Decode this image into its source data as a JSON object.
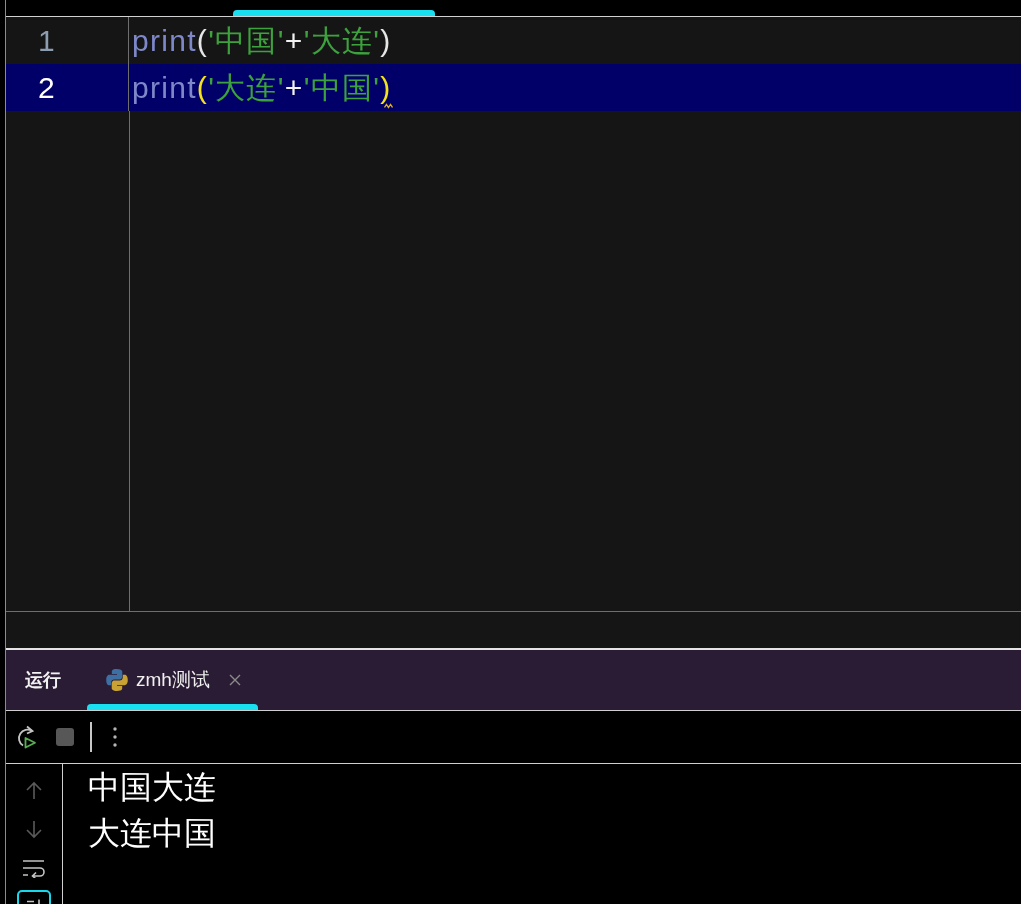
{
  "editor": {
    "lines": [
      {
        "number": "1",
        "selected": false,
        "bracket_match": false,
        "squiggle": false,
        "tokens": [
          {
            "kind": "name",
            "text": "print"
          },
          {
            "kind": "paren",
            "text": "("
          },
          {
            "kind": "string",
            "text": "'中国'"
          },
          {
            "kind": "operator",
            "text": "+"
          },
          {
            "kind": "string",
            "text": "'大连'"
          },
          {
            "kind": "paren",
            "text": ")"
          }
        ]
      },
      {
        "number": "2",
        "selected": true,
        "bracket_match": true,
        "squiggle": true,
        "tokens": [
          {
            "kind": "name",
            "text": "print"
          },
          {
            "kind": "paren",
            "text": "("
          },
          {
            "kind": "string",
            "text": "'大连'"
          },
          {
            "kind": "operator",
            "text": "+"
          },
          {
            "kind": "string",
            "text": "'中国'"
          },
          {
            "kind": "paren",
            "text": ")"
          }
        ]
      }
    ]
  },
  "run_panel": {
    "title": "运行",
    "tabs": [
      {
        "label": "zmh测试",
        "selected": true,
        "closable": true
      }
    ],
    "toolbar": [
      {
        "kind": "rerun"
      },
      {
        "kind": "stop"
      },
      {
        "kind": "separator"
      },
      {
        "kind": "more"
      }
    ],
    "side_buttons": [
      {
        "kind": "up",
        "disabled": true,
        "on": false
      },
      {
        "kind": "down",
        "disabled": true,
        "on": false
      },
      {
        "kind": "wrap",
        "disabled": false,
        "on": false
      },
      {
        "kind": "scroll-end",
        "disabled": false,
        "on": true
      }
    ],
    "output": [
      "中国大连",
      "大连中国"
    ]
  }
}
